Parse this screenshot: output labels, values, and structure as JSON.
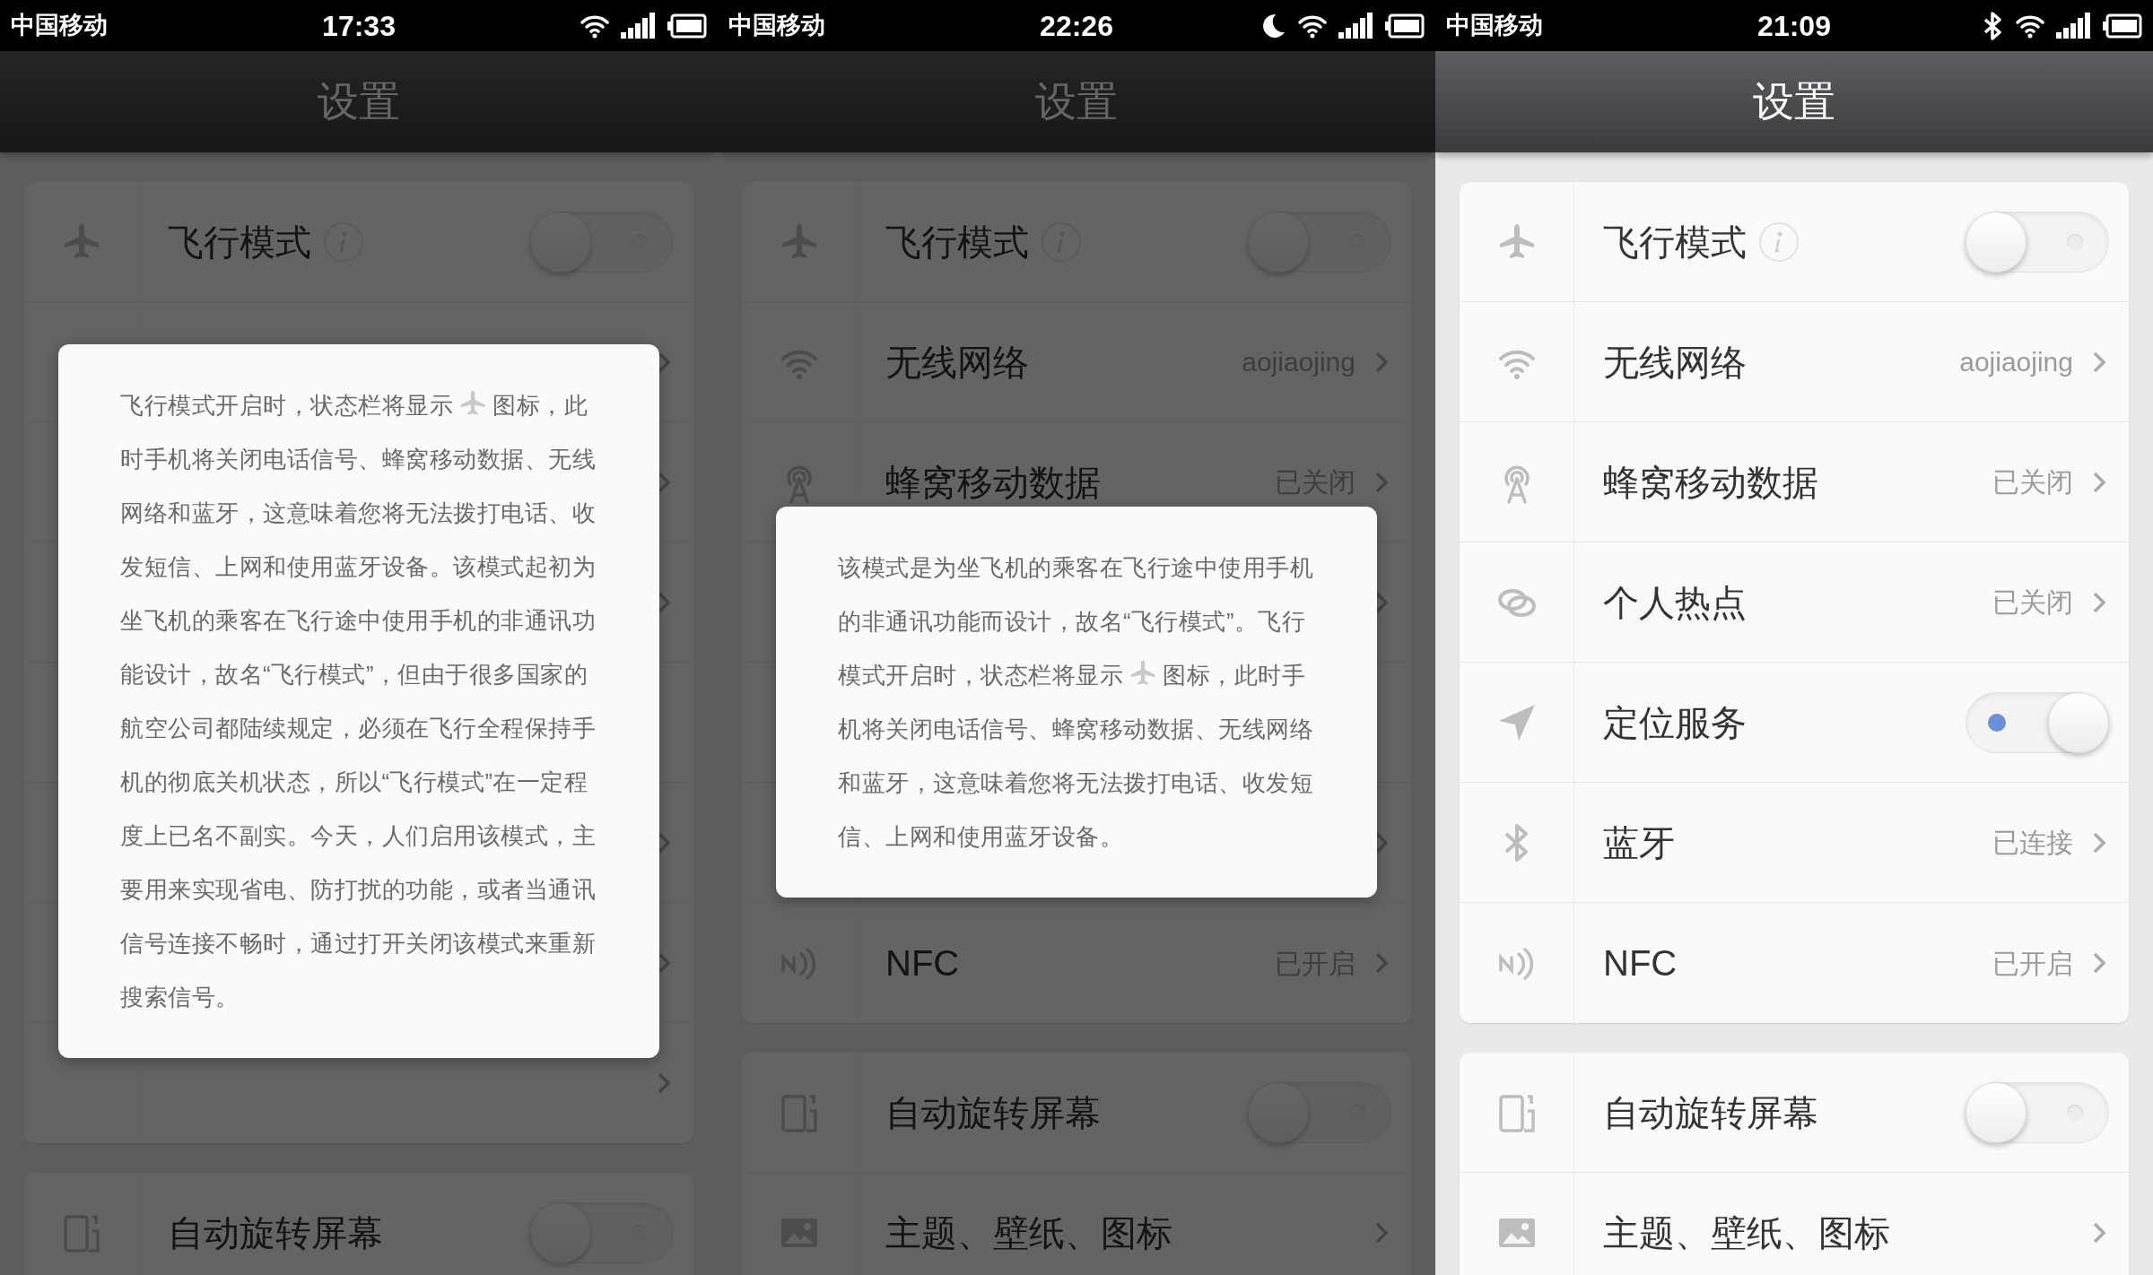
{
  "screens": [
    {
      "status_bar": {
        "carrier": "中国移动",
        "time": "17:33",
        "do_not_disturb": false,
        "bluetooth": false
      },
      "title": "设置",
      "groups": [
        {
          "rows": [
            {
              "kind": "toggle",
              "label": "飞行模式",
              "info_button": true,
              "on": false
            },
            {
              "kind": "link"
            },
            {
              "kind": "link"
            },
            {
              "kind": "link"
            },
            {
              "kind": "toggle"
            },
            {
              "kind": "link"
            },
            {
              "kind": "link"
            },
            {
              "kind": "link"
            }
          ]
        },
        {
          "rows": [
            {
              "kind": "toggle",
              "label": "自动旋转屏幕",
              "on": false
            }
          ]
        }
      ],
      "dialog": {
        "text": [
          "飞行模式开启时，状态栏将显示",
          "图标，此时手机将关闭电话信号、蜂窝移动数据、无线网络和蓝牙，这意味着您将无法拨打电话、收发短信、上网和使用蓝牙设备。该模式起初为坐飞机的乘客在飞行途中使用手机的非通讯功能设计，故名“飞行模式”，但由于很多国家的航空公司都陆续规定，必须在飞行全程保持手机的彻底关机状态，所以“飞行模式”在一定程度上已名不副实。今天，人们启用该模式，主要用来实现省电、防打扰的功能，或者当通讯信号连接不畅时，通过打开关闭该模式来重新搜索信号。"
        ]
      }
    },
    {
      "status_bar": {
        "carrier": "中国移动",
        "time": "22:26",
        "do_not_disturb": true,
        "bluetooth": false
      },
      "title": "设置",
      "groups": [
        {
          "rows": [
            {
              "kind": "toggle",
              "label": "飞行模式",
              "info_button": true,
              "on": false
            },
            {
              "kind": "link",
              "label": "无线网络",
              "value": "aojiaojing"
            },
            {
              "kind": "link",
              "label": "蜂窝移动数据",
              "value": "已关闭"
            },
            {
              "kind": "link"
            },
            {
              "kind": "toggle"
            },
            {
              "kind": "link"
            },
            {
              "kind": "link",
              "label": "NFC",
              "value": "已开启"
            }
          ]
        },
        {
          "rows": [
            {
              "kind": "toggle",
              "label": "自动旋转屏幕",
              "on": false
            },
            {
              "kind": "link",
              "label": "主题、壁纸、图标"
            }
          ]
        }
      ],
      "dialog": {
        "text": [
          "该模式是为坐飞机的乘客在飞行途中使用手机的非通讯功能而设计，故名“飞行模式”。飞行模式开启时，状态栏将显示",
          "图标，此时手机将关闭电话信号、蜂窝移动数据、无线网络和蓝牙，这意味着您将无法拨打电话、收发短信、上网和使用蓝牙设备。"
        ]
      }
    },
    {
      "status_bar": {
        "carrier": "中国移动",
        "time": "21:09",
        "do_not_disturb": false,
        "bluetooth": true
      },
      "title": "设置",
      "groups": [
        {
          "rows": [
            {
              "kind": "toggle",
              "label": "飞行模式",
              "info_button": true,
              "on": false
            },
            {
              "kind": "link",
              "label": "无线网络",
              "value": "aojiaojing"
            },
            {
              "kind": "link",
              "label": "蜂窝移动数据",
              "value": "已关闭"
            },
            {
              "kind": "link",
              "label": "个人热点",
              "value": "已关闭"
            },
            {
              "kind": "toggle",
              "label": "定位服务",
              "on": true
            },
            {
              "kind": "link",
              "label": "蓝牙",
              "value": "已连接"
            },
            {
              "kind": "link",
              "label": "NFC",
              "value": "已开启"
            }
          ]
        },
        {
          "rows": [
            {
              "kind": "toggle",
              "label": "自动旋转屏幕",
              "on": false
            },
            {
              "kind": "link",
              "label": "主题、壁纸、图标"
            }
          ]
        }
      ]
    }
  ]
}
